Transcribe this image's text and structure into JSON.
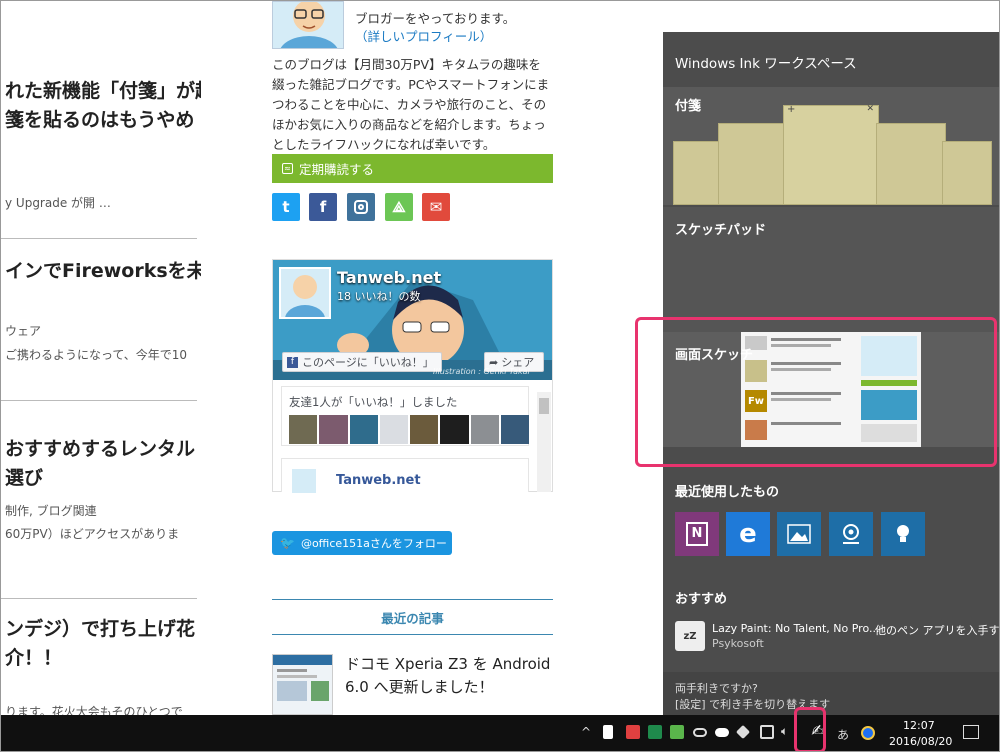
{
  "left_column": {
    "article1": {
      "title_line1": "れた新機能「付箋」が超",
      "title_line2": "箋を貼るのはもうやめ",
      "meta": "y Upgrade が開 …"
    },
    "article2": {
      "title": "インでFireworksを未",
      "category": "ウェア",
      "excerpt": "ご携わるようになって、今年で10"
    },
    "article3": {
      "title_line1": "おすすめするレンタル",
      "title_line2": "選び",
      "category": "制作, ブログ関連",
      "excerpt": "60万PV）ほどアクセスがありま"
    },
    "article4": {
      "title_line1": "ンデジ）で打ち上げ花",
      "title_line2": "介！！",
      "excerpt": "ります。花火大会もそのひとつで"
    }
  },
  "middle_column": {
    "profile_text_top": "ブロガーをやっております。",
    "profile_link": "（詳しいプロフィール）",
    "blog_description": "このブログは【月間30万PV】キタムラの趣味を綴った雑記ブログです。PCやスマートフォンにまつわることを中心に、カメラや旅行のこと、そのほかお気に入りの商品などを紹介します。ちょっとしたライフハックになれば幸いです。",
    "subscribe_label": "定期購読する",
    "social_icons": [
      "twitter-icon",
      "facebook-icon",
      "instagram-icon",
      "feedly-icon",
      "mail-icon"
    ],
    "fb_widget": {
      "page_name": "Tanweb.net",
      "likes": "18 いいね！の数",
      "like_button": "このページに「いいね！」",
      "share_button": "シェア",
      "illustration_credit": "Illustration : Genki Takai",
      "friends_text": "友達1人が「いいね！」しました",
      "post_name": "Tanweb.net"
    },
    "twitter_follow": "@office151aさんをフォロー",
    "recent_posts_heading": "最近の記事",
    "recent_post_title": "ドコモ Xperia Z3 を Android 6.0 へ更新しました！"
  },
  "ink_workspace": {
    "title": "Windows Ink ワークスペース",
    "sticky_notes_label": "付箋",
    "sketchpad_label": "スケッチパッド",
    "screen_sketch_label": "画面スケッチ",
    "recent_label": "最近使用したもの",
    "recent_apps": [
      {
        "name": "onenote-icon",
        "color": "#80397b"
      },
      {
        "name": "edge-icon",
        "color": "#1f7ad8"
      },
      {
        "name": "photos-icon",
        "color": "#1e6ea7"
      },
      {
        "name": "maps-icon",
        "color": "#1e6ea7"
      },
      {
        "name": "tips-icon",
        "color": "#1e6ea7"
      }
    ],
    "suggested_label": "おすすめ",
    "suggested_app_name": "Lazy Paint: No Talent, No Pro...",
    "suggested_app_publisher": "Psykosoft",
    "other_pen_apps": "他のペン アプリを入手する",
    "left_hand_q": "両手利きですか?",
    "left_hand_hint": "[設定] で利き手を切り替えます",
    "thumb_fw_label": "Fw"
  },
  "taskbar": {
    "time": "12:07",
    "date": "2016/08/20",
    "ime": "あ",
    "highlight_color": "#e8336e"
  }
}
